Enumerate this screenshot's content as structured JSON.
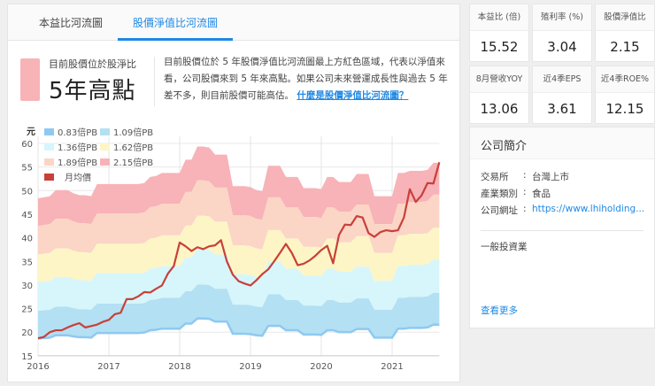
{
  "tabs": [
    {
      "label": "本益比河流圖"
    },
    {
      "label": "股價淨值比河流圖"
    }
  ],
  "summary": {
    "label": "目前股價位於股淨比",
    "level": "5年高點",
    "level_color": "#f8b3b7",
    "description": "目前股價位於 5 年股價淨值比河流圖最上方紅色區域，代表以淨值來看，公司股價來到 5 年來高點。如果公司未來營運成長性與過去 5 年差不多，則目前股價可能高估。",
    "link": "什麼是股價淨值比河流圖？"
  },
  "metrics": [
    {
      "label": "本益比 (倍)",
      "value": "15.52"
    },
    {
      "label": "殖利率 (%)",
      "value": "3.04"
    },
    {
      "label": "股價淨值比",
      "value": "2.15"
    },
    {
      "label": "8月營收YOY",
      "value": "13.06"
    },
    {
      "label": "近4季EPS",
      "value": "3.61"
    },
    {
      "label": "近4季ROE%",
      "value": "12.15"
    }
  ],
  "profile": {
    "title": "公司簡介",
    "rows": [
      {
        "k": "交易所",
        "v": "台灣上市"
      },
      {
        "k": "產業類別",
        "v": "食品"
      },
      {
        "k": "公司網址",
        "v": "https://www.lhiholding..."
      }
    ],
    "business": "一般投資業",
    "more": "查看更多"
  },
  "chart_data": {
    "type": "area",
    "ylabel": "元",
    "ylim": [
      15,
      62
    ],
    "y_ticks": [
      "15",
      "20",
      "25",
      "30",
      "35",
      "40",
      "45",
      "50",
      "55",
      "60"
    ],
    "x_ticks": [
      "2016",
      "2017",
      "2018",
      "2019",
      "2020",
      "2021"
    ],
    "x_start": 2016,
    "months": 69,
    "multiples": [
      0.83,
      1.09,
      1.36,
      1.62,
      1.89,
      2.15
    ],
    "band_names": [
      "0.83倍PB",
      "1.09倍PB",
      "1.36倍PB",
      "1.62倍PB",
      "1.89倍PB",
      "2.15倍PB"
    ],
    "band_colors": [
      "#8ec9f2",
      "#b3e0f2",
      "#d6f6fb",
      "#fdf5c6",
      "#fbd5c6",
      "#f7b3b7"
    ],
    "price_name": "月均價",
    "price_color": "#c8403a",
    "bvps": [
      22.5,
      22.6,
      22.7,
      23.3,
      23.3,
      23.3,
      23.0,
      22.8,
      22.8,
      22.7,
      23.9,
      23.9,
      23.9,
      23.9,
      23.9,
      23.9,
      23.9,
      23.9,
      24.0,
      24.6,
      24.7,
      25.0,
      25.0,
      25.0,
      25.0,
      26.3,
      26.3,
      27.6,
      27.6,
      27.5,
      26.8,
      26.8,
      26.8,
      23.7,
      23.7,
      23.7,
      23.6,
      23.3,
      23.2,
      25.7,
      25.7,
      25.7,
      24.6,
      24.6,
      24.6,
      23.5,
      23.5,
      23.5,
      23.4,
      24.6,
      24.6,
      24.1,
      24.1,
      24.1,
      24.9,
      24.9,
      24.9,
      22.7,
      22.7,
      22.7,
      22.7,
      25.0,
      25.0,
      25.2,
      25.2,
      25.2,
      25.3,
      26.0,
      26.0
    ],
    "price": [
      18.7,
      19,
      20,
      20.4,
      20.4,
      21,
      21.5,
      21.9,
      21,
      21.3,
      21.6,
      22.2,
      22.6,
      23.8,
      24.1,
      27,
      27,
      27.6,
      28.5,
      28.4,
      29.2,
      29.9,
      32.4,
      34,
      39,
      38.2,
      37.2,
      38,
      37.6,
      38.2,
      38.4,
      39.5,
      35,
      32.2,
      30.8,
      30.3,
      29.9,
      31,
      32.3,
      33.3,
      35,
      36.8,
      38.7,
      36.8,
      34.2,
      34.5,
      35.2,
      36.2,
      37.4,
      38.3,
      34.6,
      40.6,
      42.8,
      42.7,
      44.6,
      44.3,
      41,
      40.2,
      41.2,
      41.6,
      41.4,
      41.6,
      44.3,
      50.3,
      47.6,
      49,
      51.6,
      51.5,
      56
    ]
  }
}
